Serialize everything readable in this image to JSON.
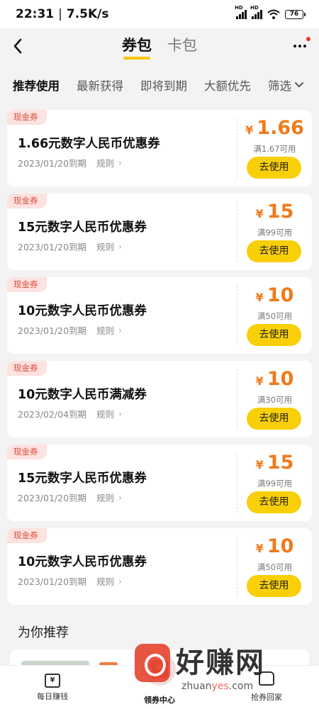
{
  "status_bar": {
    "time": "22:31",
    "net_speed": "7.5K/s",
    "signal_1": "HD",
    "signal_2": "HD",
    "battery": "76"
  },
  "header": {
    "tabs": [
      {
        "label": "券包",
        "active": true
      },
      {
        "label": "卡包",
        "active": false
      }
    ],
    "more_badge_color": "#e32222"
  },
  "filters": {
    "items": [
      "推荐使用",
      "最新获得",
      "即将到期",
      "大额优先"
    ],
    "active": "推荐使用",
    "dropdown_label": "筛选"
  },
  "coupons": [
    {
      "tag": "现金券",
      "title": "1.66元数字人民币优惠券",
      "expiry": "2023/01/20到期",
      "rule_label": "规则",
      "currency": "¥",
      "amount": "1.66",
      "condition": "满1.67可用",
      "button": "去使用"
    },
    {
      "tag": "现金券",
      "title": "15元数字人民币优惠券",
      "expiry": "2023/01/20到期",
      "rule_label": "规则",
      "currency": "¥",
      "amount": "15",
      "condition": "满99可用",
      "button": "去使用"
    },
    {
      "tag": "现金券",
      "title": "10元数字人民币优惠券",
      "expiry": "2023/01/20到期",
      "rule_label": "规则",
      "currency": "¥",
      "amount": "10",
      "condition": "满50可用",
      "button": "去使用"
    },
    {
      "tag": "现金券",
      "title": "10元数字人民币满减券",
      "expiry": "2023/02/04到期",
      "rule_label": "规则",
      "currency": "¥",
      "amount": "10",
      "condition": "满30可用",
      "button": "去使用"
    },
    {
      "tag": "现金券",
      "title": "15元数字人民币优惠券",
      "expiry": "2023/01/20到期",
      "rule_label": "规则",
      "currency": "¥",
      "amount": "15",
      "condition": "满99可用",
      "button": "去使用"
    },
    {
      "tag": "现金券",
      "title": "10元数字人民币优惠券",
      "expiry": "2023/01/20到期",
      "rule_label": "规则",
      "currency": "¥",
      "amount": "10",
      "condition": "满50可用",
      "button": "去使用"
    }
  ],
  "recommend": {
    "title": "为你推荐"
  },
  "bottom_nav": {
    "items": [
      {
        "label": "每日赚钱",
        "icon": "wallet-icon"
      },
      {
        "label": "领券中心",
        "icon": "red-envelope-icon",
        "active": true
      },
      {
        "label": "抢券回家",
        "icon": "home-icon"
      }
    ]
  },
  "watermark": {
    "text": "好赚网",
    "url_prefix": "zhuan",
    "url_highlight": "yes",
    "url_suffix": ".com"
  },
  "colors": {
    "accent_yellow": "#f8cf08",
    "price_orange": "#f07a1a",
    "tag_bg": "#fde2df",
    "tag_text": "#d64a38"
  }
}
